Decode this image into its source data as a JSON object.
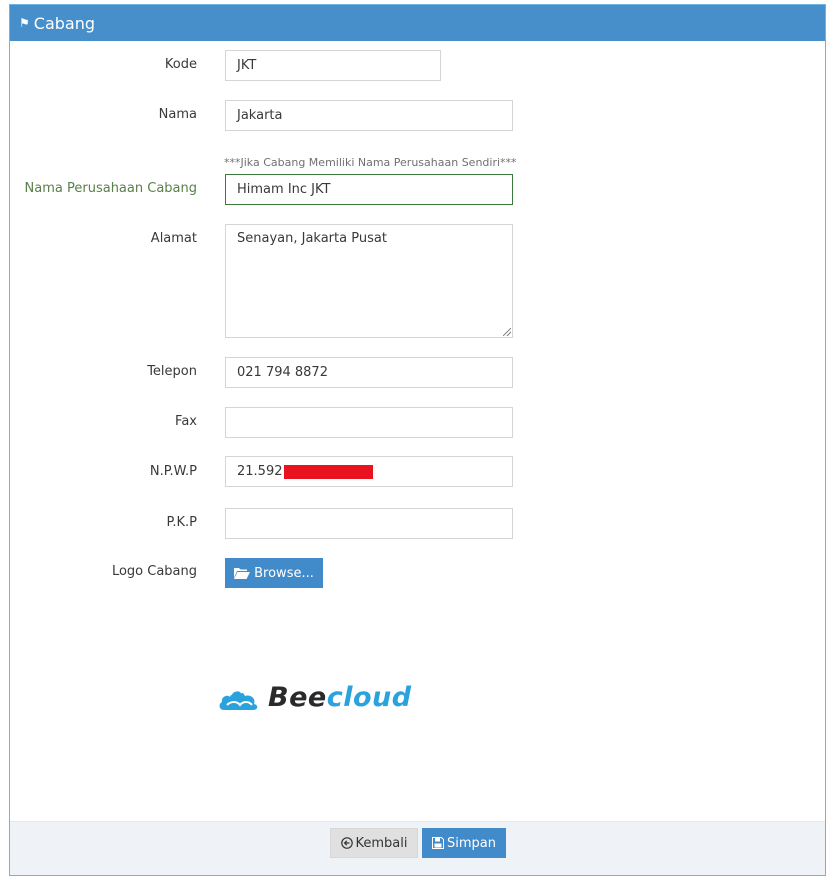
{
  "header": {
    "title": "Cabang",
    "icon": "flag-icon"
  },
  "form": {
    "kode": {
      "label": "Kode",
      "value": "JKT"
    },
    "nama": {
      "label": "Nama",
      "value": "Jakarta"
    },
    "hint": "***Jika Cabang Memiliki Nama Perusahaan Sendiri***",
    "nama_perusahaan": {
      "label": "Nama Perusahaan Cabang",
      "value": "Himam Inc JKT"
    },
    "alamat": {
      "label": "Alamat",
      "value": "Senayan, Jakarta Pusat"
    },
    "telepon": {
      "label": "Telepon",
      "value": "021 794 8872"
    },
    "fax": {
      "label": "Fax",
      "value": ""
    },
    "npwp": {
      "label": "N.P.W.P",
      "value": "21.592"
    },
    "pkp": {
      "label": "P.K.P",
      "value": ""
    },
    "logo": {
      "label": "Logo Cabang",
      "browse_label": "Browse..."
    }
  },
  "logo_preview": {
    "text_part1": "Bee",
    "text_part2": "cloud"
  },
  "footer": {
    "back_label": "Kembali",
    "save_label": "Simpan"
  },
  "colors": {
    "header": "#478fca",
    "primary_button": "#428bca",
    "redaction": "#e8131f",
    "brand_cloud": "#2aa3dd"
  }
}
